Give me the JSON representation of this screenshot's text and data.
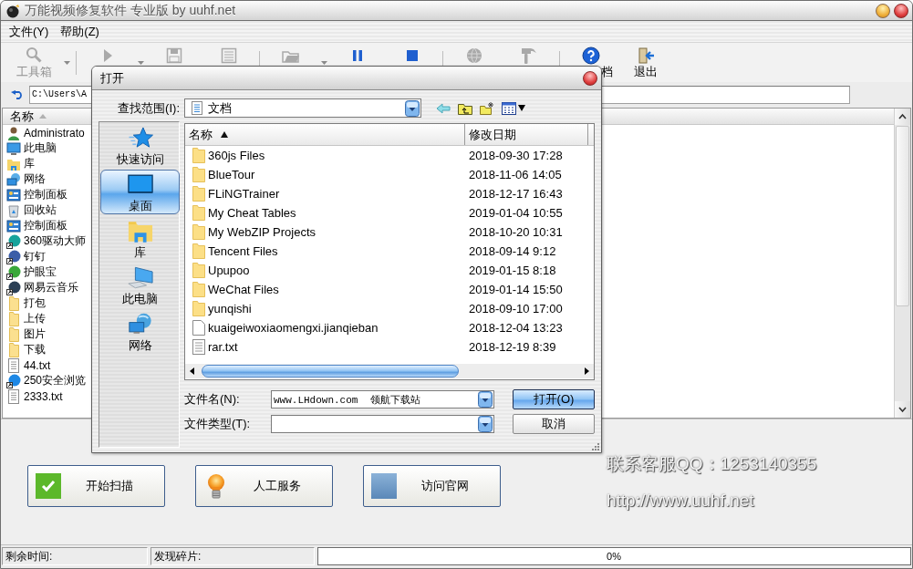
{
  "window": {
    "title": "万能视频修复软件 专业版 by uuhf.net"
  },
  "menu": [
    {
      "label": "文件(Y)"
    },
    {
      "label": "帮助(Z)"
    }
  ],
  "toolbar": [
    {
      "label": "工具箱",
      "disabled": true,
      "dropdown": true
    },
    {
      "disabled": true,
      "dropdown": true
    },
    {
      "disabled": true,
      "dropdown": false
    },
    {
      "disabled": true,
      "dropdown": false
    },
    {
      "disabled": true,
      "dropdown": true
    },
    {
      "disabled": false,
      "dropdown": false
    },
    {
      "disabled": false,
      "dropdown": false
    },
    {
      "disabled": true,
      "dropdown": false
    },
    {
      "disabled": true,
      "dropdown": false
    },
    {
      "label": "档",
      "disabled": false,
      "dropdown": false
    },
    {
      "label": "退出",
      "disabled": false,
      "dropdown": false
    }
  ],
  "address": {
    "value": "C:\\Users\\A"
  },
  "file_list": {
    "columns": [
      {
        "label": "名称",
        "sorted": true
      }
    ],
    "items": [
      {
        "name": "Administrato",
        "kind": "user"
      },
      {
        "name": "此电脑",
        "kind": "computer"
      },
      {
        "name": "库",
        "kind": "library"
      },
      {
        "name": "网络",
        "kind": "network"
      },
      {
        "name": "控制面板",
        "kind": "control_panel"
      },
      {
        "name": "回收站",
        "kind": "recycle_bin"
      },
      {
        "name": "控制面板",
        "kind": "control_panel"
      },
      {
        "name": "360驱动大师",
        "kind": "shortcut"
      },
      {
        "name": "钉钉",
        "kind": "shortcut"
      },
      {
        "name": "护眼宝",
        "kind": "shortcut"
      },
      {
        "name": "网易云音乐",
        "kind": "shortcut"
      },
      {
        "name": "打包",
        "kind": "folder"
      },
      {
        "name": "上传",
        "kind": "folder"
      },
      {
        "name": "图片",
        "kind": "folder"
      },
      {
        "name": "下载",
        "kind": "folder"
      },
      {
        "name": "44.txt",
        "kind": "text"
      },
      {
        "name": "250安全浏览",
        "kind": "shortcut"
      },
      {
        "name": "2333.txt",
        "kind": "text"
      }
    ]
  },
  "bottom_buttons": [
    {
      "label": "开始扫描"
    },
    {
      "label": "人工服务"
    },
    {
      "label": "访问官网"
    }
  ],
  "contact": [
    "联系客服QQ：1253140355",
    "http://www.uuhf.net"
  ],
  "status_bar": {
    "cells": [
      "剩余时间:",
      "发现碎片:"
    ],
    "progress": {
      "level": 0,
      "text": "0%"
    }
  },
  "dialog": {
    "title": "打开",
    "look_in": {
      "label": "查找范围(I):",
      "value": "文档"
    },
    "places": [
      {
        "label": "快速访问",
        "selected": false
      },
      {
        "label": "桌面",
        "selected": true
      },
      {
        "label": "库",
        "selected": false
      },
      {
        "label": "此电脑",
        "selected": false
      },
      {
        "label": "网络",
        "selected": false
      }
    ],
    "columns": [
      {
        "label": "名称",
        "sorted": true
      },
      {
        "label": "修改日期",
        "sorted": false
      }
    ],
    "files": [
      {
        "name": "360js Files",
        "date": "2018-09-30 17:28",
        "kind": "folder"
      },
      {
        "name": "BlueTour",
        "date": "2018-11-06 14:05",
        "kind": "folder"
      },
      {
        "name": "FLiNGTrainer",
        "date": "2018-12-17 16:43",
        "kind": "folder"
      },
      {
        "name": "My Cheat Tables",
        "date": "2019-01-04 10:55",
        "kind": "folder"
      },
      {
        "name": "My WebZIP Projects",
        "date": "2018-10-20 10:31",
        "kind": "folder"
      },
      {
        "name": "Tencent Files",
        "date": "2018-09-14 9:12",
        "kind": "folder"
      },
      {
        "name": "Upupoo",
        "date": "2019-01-15 8:18",
        "kind": "folder"
      },
      {
        "name": "WeChat Files",
        "date": "2019-01-14 15:50",
        "kind": "folder"
      },
      {
        "name": "yunqishi",
        "date": "2018-09-10 17:00",
        "kind": "folder"
      },
      {
        "name": "kuaigeiwoxiaomengxi.jianqieban",
        "date": "2018-12-04 13:23",
        "kind": "file"
      },
      {
        "name": "rar.txt",
        "date": "2018-12-19 8:39",
        "kind": "text"
      }
    ],
    "file_name": {
      "label": "文件名(N):",
      "value": "www.LHdown.com  领航下载站"
    },
    "file_type": {
      "label": "文件类型(T):"
    },
    "buttons": [
      {
        "label": "打开(O)",
        "default": true
      },
      {
        "label": "取消",
        "default": false
      }
    ]
  }
}
